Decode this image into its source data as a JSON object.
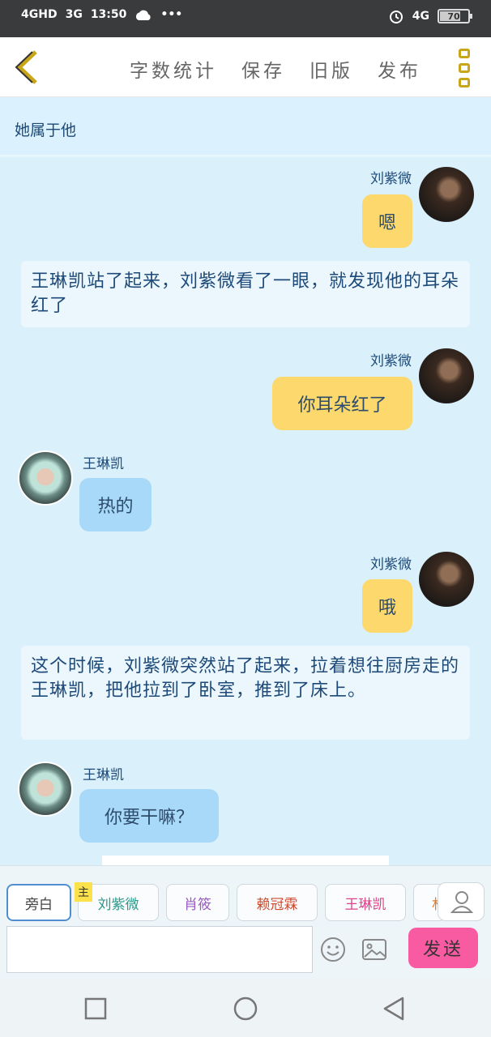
{
  "status_bar": {
    "network_left": "4GHD",
    "network_left2": "3G",
    "time": "13:50",
    "network_right": "4G",
    "battery": "70",
    "battery_level": 0.7
  },
  "toolbar": {
    "word_count": "字数统计",
    "save": "保存",
    "old_version": "旧版",
    "publish": "发布"
  },
  "story_title": "她属于他",
  "messages": {
    "m1_name": "刘紫微",
    "m1_text": "嗯",
    "n1_text": "王琳凯站了起来，刘紫微看了一眼，就发现他的耳朵红了",
    "m2_name": "刘紫微",
    "m2_text": "你耳朵红了",
    "m3_name": "王琳凯",
    "m3_text": "热的",
    "m4_name": "刘紫微",
    "m4_text": "哦",
    "n2_text": "这个时候，刘紫微突然站了起来，拉着想往厨房走的王琳凯，把他拉到了卧室，推到了床上。",
    "m5_name": "王琳凯",
    "m5_text": "你要干嘛？"
  },
  "roles": {
    "narration": "旁白",
    "main_badge": "主",
    "chip1": "刘紫微",
    "chip2": "肖筱",
    "chip3": "赖冠霖",
    "chip4": "王琳凯",
    "chip5_partial": "林",
    "chip1_color": "#2a9a8a",
    "chip2_color": "#9a5ac2",
    "chip3_color": "#d04a2e",
    "chip4_color": "#e0408a"
  },
  "composer": {
    "placeholder": "",
    "send": "发送"
  },
  "colors": {
    "accent_yellow": "#fcd86d",
    "accent_blue": "#a8d9f8",
    "send_pink": "#f95ba2",
    "text_blue": "#1d4a78"
  }
}
